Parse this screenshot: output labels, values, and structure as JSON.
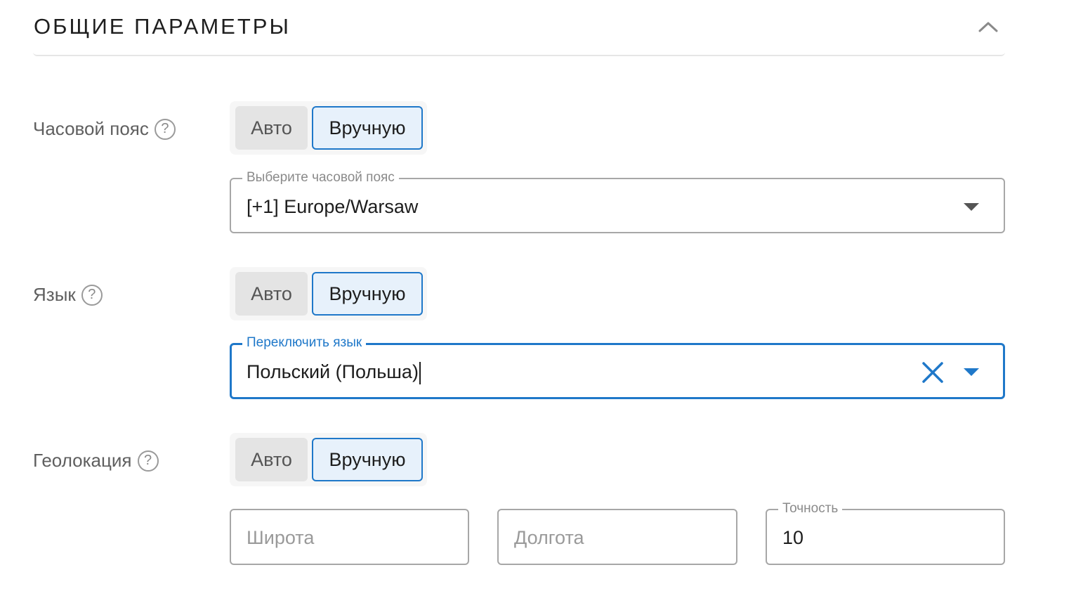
{
  "section": {
    "title": "ОБЩИЕ ПАРАМЕТРЫ",
    "collapse_icon": "chevron-up-icon"
  },
  "timezone": {
    "label": "Часовой пояс",
    "help": "?",
    "toggle": {
      "auto": "Авто",
      "manual": "Вручную",
      "selected": "manual"
    },
    "select": {
      "label": "Выберите часовой пояс",
      "value": "[+1] Europe/Warsaw"
    }
  },
  "language": {
    "label": "Язык",
    "help": "?",
    "toggle": {
      "auto": "Авто",
      "manual": "Вручную",
      "selected": "manual"
    },
    "select": {
      "label": "Переключить язык",
      "value": "Польский (Польша)",
      "focused": true
    }
  },
  "geolocation": {
    "label": "Геолокация",
    "help": "?",
    "toggle": {
      "auto": "Авто",
      "manual": "Вручную",
      "selected": "manual"
    },
    "latitude": {
      "placeholder": "Широта",
      "value": ""
    },
    "longitude": {
      "placeholder": "Долгота",
      "value": ""
    },
    "accuracy": {
      "label": "Точность",
      "value": "10"
    }
  },
  "colors": {
    "accent": "#1f78c9",
    "selected_bg": "#e7f1fb",
    "unselected_bg": "#e4e4e4"
  }
}
